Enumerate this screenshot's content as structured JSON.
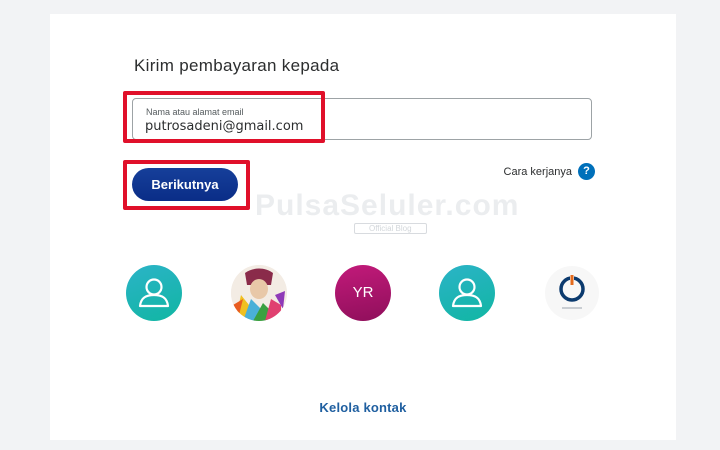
{
  "send": {
    "heading": "Kirim pembayaran kepada",
    "field_label": "Nama atau alamat email",
    "field_value": "putrosadeni@gmail.com",
    "next_label": "Berikutnya",
    "how_label": "Cara kerjanya",
    "help_glyph": "?"
  },
  "watermark": {
    "text": "PulsaSeluler.com",
    "sub": "Official Blog"
  },
  "contacts": [
    {
      "icon": "person-icon",
      "color": "#1fb5b7"
    },
    {
      "icon": "photo-avatar"
    },
    {
      "initials": "YR",
      "color": "#b3156f"
    },
    {
      "icon": "person-icon",
      "color": "#1fb5b7"
    },
    {
      "icon": "power-logo-icon"
    }
  ],
  "footer": {
    "manage_label": "Kelola kontak"
  },
  "colors": {
    "accent": "#0b3ea7",
    "link": "#1f5fa0",
    "highlight": "#e0102a",
    "help": "#0070ba"
  }
}
